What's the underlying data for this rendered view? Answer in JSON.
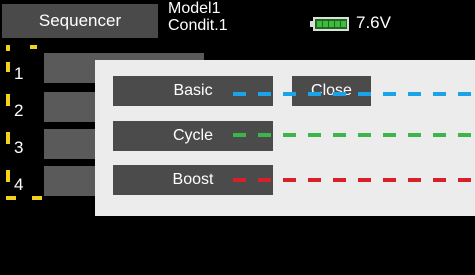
{
  "header": {
    "title": "Sequencer",
    "model": "Model1",
    "condition": "Condit.1",
    "battery_voltage": "7.6V"
  },
  "list": {
    "numbers": [
      "1",
      "2",
      "3",
      "4"
    ]
  },
  "dialog": {
    "basic_label": "Basic",
    "close_label": "Close",
    "cycle_label": "Cycle",
    "boost_label": "Boost"
  },
  "colors": {
    "basic_line": "#1aa3e8",
    "cycle_line": "#3cb54a",
    "boost_line": "#d8202a",
    "marker": "#f2d21a"
  },
  "icons": {
    "battery": "battery-icon"
  }
}
